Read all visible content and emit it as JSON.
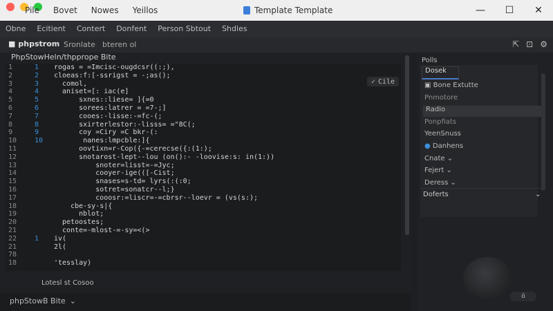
{
  "window": {
    "title": "Template Template",
    "controls": [
      "—",
      "☐",
      "✕"
    ]
  },
  "title_menu": [
    "Pile",
    "Bovet",
    "Nowes",
    "Yeillos"
  ],
  "menubar": [
    "Obne",
    "Ecitient",
    "Contert",
    "Donfent",
    "Person Sbtout",
    "Shdles"
  ],
  "toolbar": {
    "logo": "phpstrom",
    "tab1": "Sronlate",
    "tab2": "bteren ol",
    "icons": [
      "⇱",
      "⊡",
      "⚙"
    ]
  },
  "project_title": "PhpStowHeln/thpprope Bite",
  "clear_button": "Cile",
  "line_numbers": [
    [
      "1",
      "1"
    ],
    [
      "2",
      "2"
    ],
    [
      "3",
      "3"
    ],
    [
      "4",
      "4"
    ],
    [
      "5",
      "5"
    ],
    [
      "6",
      "6"
    ],
    [
      "7",
      "7"
    ],
    [
      "8",
      "8"
    ],
    [
      "9",
      "9"
    ],
    [
      "10",
      "10"
    ],
    [
      "11",
      ""
    ],
    [
      "12",
      ""
    ],
    [
      "13",
      ""
    ],
    [
      "14",
      ""
    ],
    [
      "15",
      ""
    ],
    [
      "16",
      ""
    ],
    [
      "17",
      ""
    ],
    [
      "18",
      ""
    ],
    [
      "19",
      ""
    ],
    [
      "20",
      ""
    ],
    [
      "21",
      ""
    ],
    [
      "22",
      "1"
    ],
    [
      "21",
      ""
    ],
    [
      "78",
      ""
    ],
    [
      "18",
      ""
    ]
  ],
  "code_lines": [
    "rogas = =Imcisc-ougdcsr((:;),",
    "cloeas:f:[-ssrigst = -;as();",
    "  comol,",
    "  aniset=[: iac(e]",
    "      sxnes::liese= ]{=0",
    "      sorees:latrer = =7-;]",
    "      cooes:-lisse:-=fc-(;",
    "      sxirterlestor:-lisss= =\"8C(;",
    "      coy =Ciry =C bkr-(:",
    "       nanes:lmpcble:]{",
    "      oovtixn=r-Cop({-=cerecse({:(1:);",
    "      snotarost-lept--lou (on():- -loovise:s: in(1:))",
    "          snoter=lisst=-=Jyc;",
    "          cooyer-ige(([-Cist;",
    "          snases=s-td= lyrs(:(:0;",
    "          sotret=sonatcr--l;}",
    "          cooosr:=liscr=-=cbrsr--loevr = (vs(s:);",
    "    cbe-sy-s|{",
    "      nblot;",
    "  petoostes;",
    "  conte=-mlost-=-sy=<(>",
    "iv(",
    "2l(",
    "",
    "'tesslay)"
  ],
  "footer_tabs": "Lotesl st Cosoo",
  "bottom_select": "phpStowB Bite",
  "right_header": "Polls",
  "right_tab": "Dosek",
  "right_items": [
    {
      "label": "Bone Extutte",
      "icon": "square"
    },
    {
      "label": "Pnmotore",
      "dim": true
    },
    {
      "label": "Radio",
      "sel": true
    },
    {
      "label": "Ponpfiats",
      "dim": true
    },
    {
      "label": "YeenSnuss"
    },
    {
      "label": "Danhens",
      "icon": "dot"
    },
    {
      "label": "Cnate",
      "chev": true
    },
    {
      "label": "Fejert",
      "chev": true
    },
    {
      "label": "Deress",
      "chev": true
    }
  ],
  "defaults_label": "Doferts",
  "right_button": "ö",
  "colors": {
    "accent": "#4b79c9",
    "line_number_alt": "#3a8fd9",
    "dot_red": "#fe5f57",
    "dot_yellow": "#febc2e",
    "dot_green": "#28c840"
  }
}
